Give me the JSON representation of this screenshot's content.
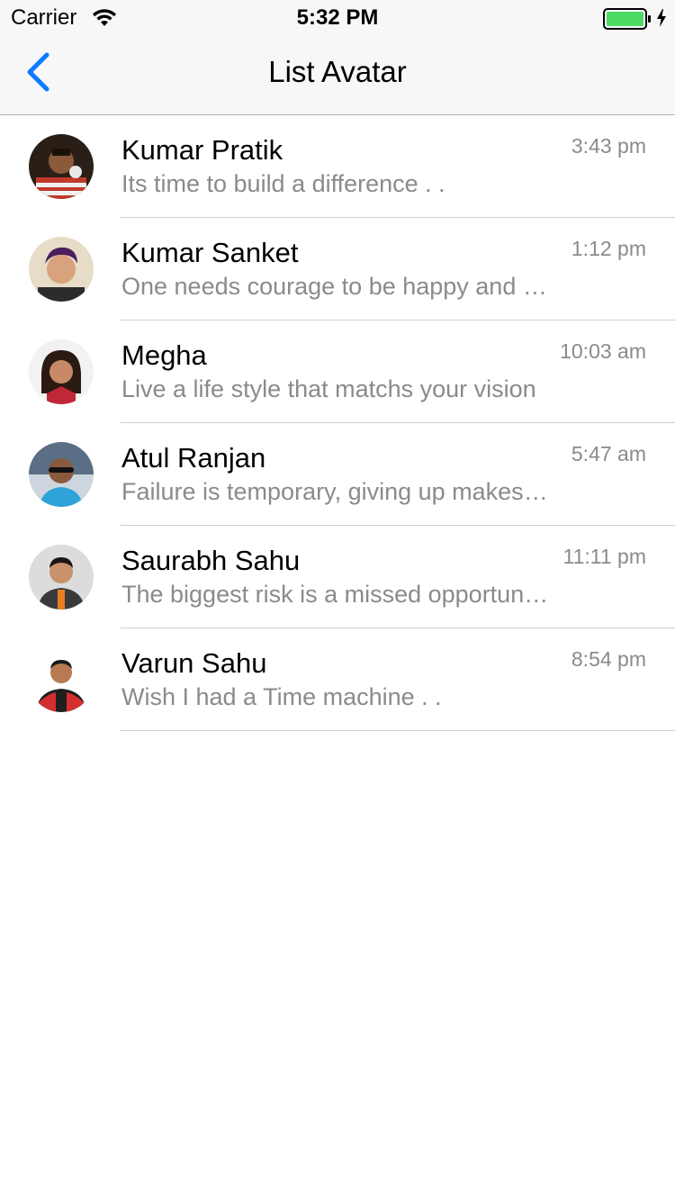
{
  "status_bar": {
    "carrier": "Carrier",
    "time": "5:32 PM",
    "battery_color": "#4cd964"
  },
  "nav": {
    "title": "List Avatar",
    "back_icon": "chevron-left-icon",
    "accent_color": "#0a7aff"
  },
  "items": [
    {
      "name": "Kumar Pratik",
      "message": "Its time to build a difference . .",
      "time": "3:43 pm",
      "avatar": "avatar-photo"
    },
    {
      "name": "Kumar Sanket",
      "message": "One needs courage to be happy and smiling all the time . .",
      "time": "1:12 pm",
      "avatar": "avatar-photo"
    },
    {
      "name": "Megha",
      "message": "Live a life style that matchs your vision",
      "time": "10:03 am",
      "avatar": "avatar-photo"
    },
    {
      "name": "Atul Ranjan",
      "message": "Failure is temporary, giving up makes it permanent",
      "time": "5:47 am",
      "avatar": "avatar-photo"
    },
    {
      "name": "Saurabh Sahu",
      "message": "The biggest risk is a missed opportunity !!",
      "time": "11:11 pm",
      "avatar": "avatar-photo"
    },
    {
      "name": "Varun Sahu",
      "message": "Wish I had a Time machine . .",
      "time": "8:54 pm",
      "avatar": "avatar-photo"
    }
  ]
}
